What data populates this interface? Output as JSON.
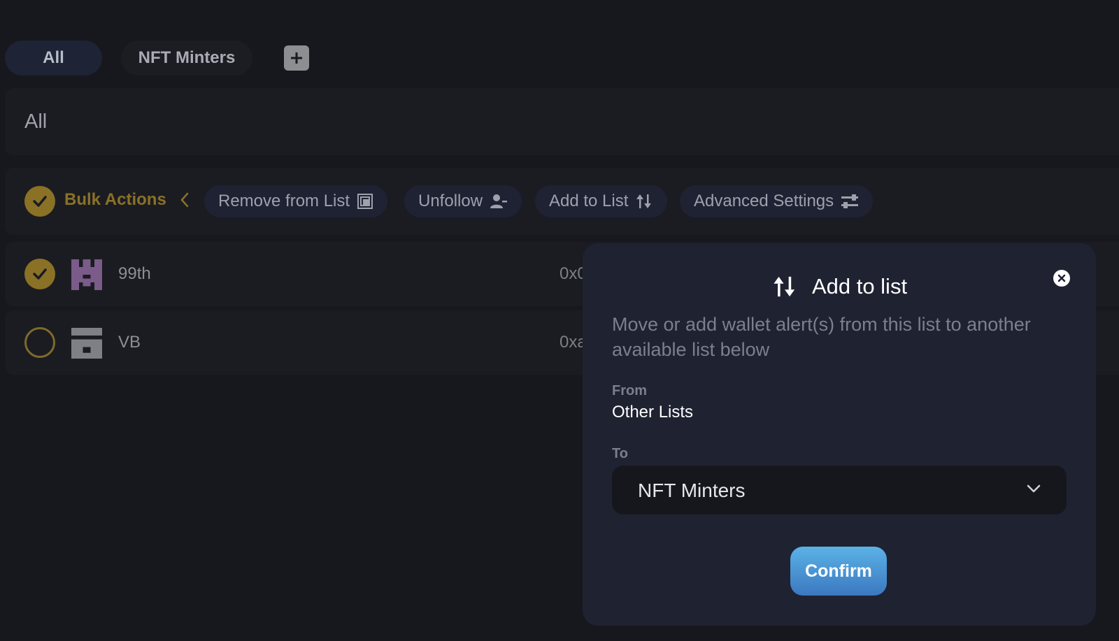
{
  "tabs": [
    {
      "label": "All",
      "active": true
    },
    {
      "label": "NFT Minters",
      "active": false
    }
  ],
  "list_header": {
    "title": "All"
  },
  "bulk_bar": {
    "label": "Bulk Actions",
    "actions": [
      {
        "label": "Remove from List",
        "icon": "remove-from-list-icon"
      },
      {
        "label": "Unfollow",
        "icon": "unfollow-user-icon"
      },
      {
        "label": "Add to List",
        "icon": "sort-arrows-icon"
      },
      {
        "label": "Advanced Settings",
        "icon": "sliders-icon"
      }
    ]
  },
  "rows": [
    {
      "name": "99th",
      "address": "0x0",
      "selected": true,
      "avatar_color": "#7a5b8a"
    },
    {
      "name": "VB",
      "address": "0xa",
      "selected": false,
      "avatar_color": "#7f8085"
    }
  ],
  "modal": {
    "title": "Add to list",
    "description": "Move or add wallet alert(s) from this list to another available list below",
    "from_label": "From",
    "from_value": "Other Lists",
    "to_label": "To",
    "to_selected": "NFT Minters",
    "confirm_label": "Confirm"
  },
  "colors": {
    "background": "#17181d",
    "accent_gold": "#8a7126",
    "modal_bg": "#1f2231",
    "confirm_top": "#5bb2e6",
    "confirm_bottom": "#3b78c0"
  }
}
